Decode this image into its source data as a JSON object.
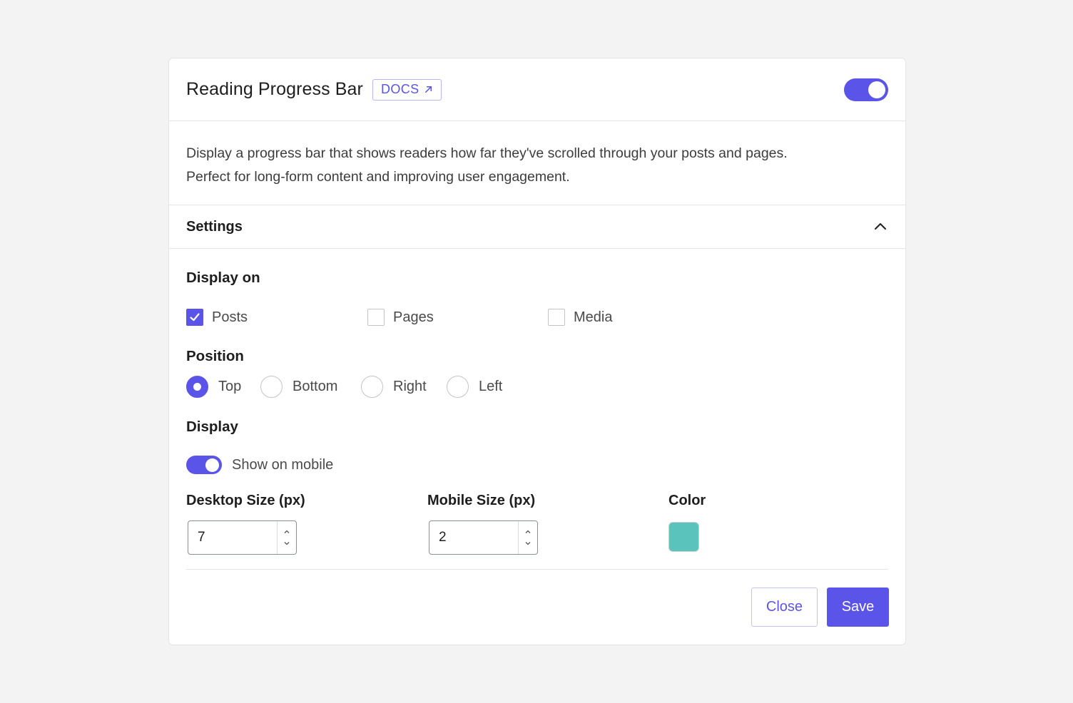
{
  "header": {
    "title": "Reading Progress Bar",
    "docs_label": "DOCS",
    "docs_icon": "external-link-icon",
    "enabled": true
  },
  "description": {
    "line1": "Display a progress bar that shows readers how far they've scrolled through your posts and pages.",
    "line2": "Perfect for long-form content and improving user engagement."
  },
  "settings": {
    "label": "Settings",
    "expanded": true,
    "display_on": {
      "label": "Display on",
      "options": [
        {
          "label": "Posts",
          "checked": true
        },
        {
          "label": "Pages",
          "checked": false
        },
        {
          "label": "Media",
          "checked": false
        }
      ]
    },
    "position": {
      "label": "Position",
      "options": [
        {
          "label": "Top",
          "selected": true
        },
        {
          "label": "Bottom",
          "selected": false
        },
        {
          "label": "Right",
          "selected": false
        },
        {
          "label": "Left",
          "selected": false
        }
      ]
    },
    "display": {
      "label": "Display",
      "show_on_mobile_label": "Show on mobile",
      "show_on_mobile": true
    },
    "desktop_size": {
      "label": "Desktop Size (px)",
      "value": "7"
    },
    "mobile_size": {
      "label": "Mobile Size (px)",
      "value": "2"
    },
    "color": {
      "label": "Color",
      "value": "#5ac4bc"
    }
  },
  "footer": {
    "close_label": "Close",
    "save_label": "Save"
  },
  "theme": {
    "accent": "#5b54e8"
  }
}
